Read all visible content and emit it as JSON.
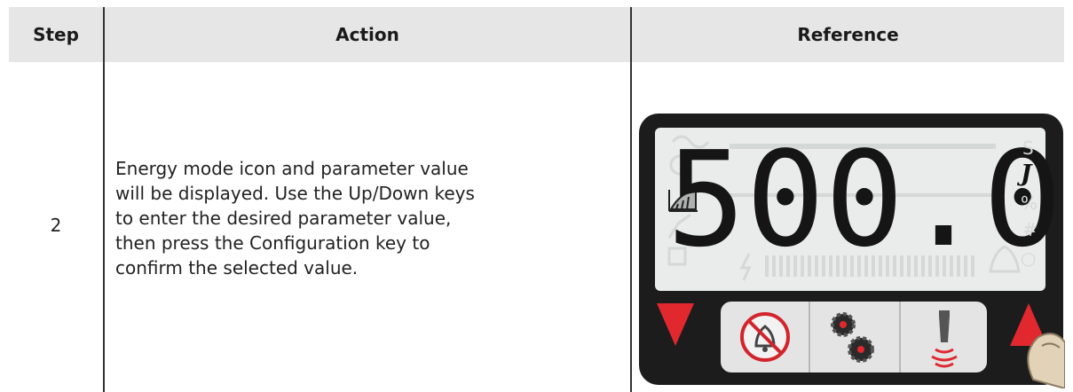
{
  "table": {
    "headers": {
      "step": "Step",
      "action": "Action",
      "reference": "Reference"
    },
    "row": {
      "step": "2",
      "action_lines": [
        "Energy mode icon and parameter value",
        "will be displayed. Use the Up/Down keys",
        "to enter the desired parameter value,",
        "then press the Configuration key to",
        "confirm the selected value."
      ]
    }
  },
  "display": {
    "value": "500.0",
    "unit": "J",
    "side_units": [
      "S",
      "%",
      "#",
      "○"
    ],
    "background": "#e9ecea",
    "ghost": "#d4d8d6"
  },
  "keypad": {
    "down_arrow_color": "#e0282e",
    "up_arrow_color": "#e0282e",
    "buttons": [
      "alarm-reset-icon",
      "configuration-icon",
      "horn-test-icon"
    ]
  },
  "colors": {
    "header_bg": "#e6e6e6",
    "device_body": "#1c1c1c"
  }
}
